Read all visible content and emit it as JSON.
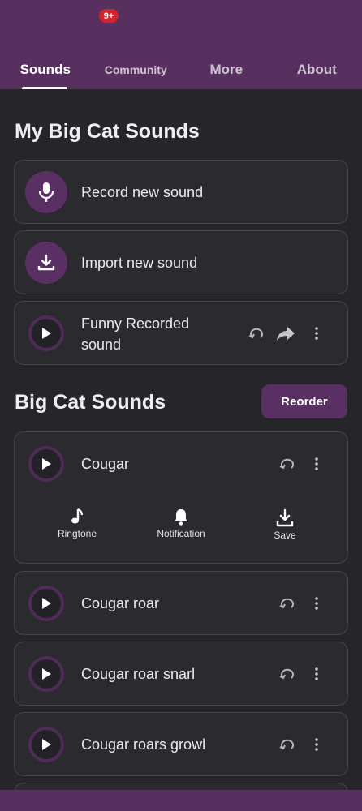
{
  "tabs": [
    {
      "label": "Sounds",
      "active": true
    },
    {
      "label": "Community",
      "badge": "9+"
    },
    {
      "label": "More"
    },
    {
      "label": "About"
    }
  ],
  "my_sounds": {
    "title": "My Big Cat Sounds",
    "record_label": "Record new sound",
    "import_label": "Import new sound",
    "items": [
      {
        "label": "Funny Recorded sound"
      }
    ]
  },
  "big_cat_sounds": {
    "title": "Big Cat Sounds",
    "reorder_label": "Reorder",
    "expanded_item": {
      "label": "Cougar",
      "actions": [
        {
          "label": "Ringtone",
          "icon": "music-note-icon"
        },
        {
          "label": "Notification",
          "icon": "bell-icon"
        },
        {
          "label": "Save",
          "icon": "download-icon"
        }
      ]
    },
    "items": [
      {
        "label": "Cougar roar"
      },
      {
        "label": "Cougar roar snarl"
      },
      {
        "label": "Cougar roars growl"
      }
    ]
  },
  "colors": {
    "accent": "#58305f",
    "background": "#262529",
    "card": "#2b2a2e",
    "badge": "#d3242d"
  }
}
